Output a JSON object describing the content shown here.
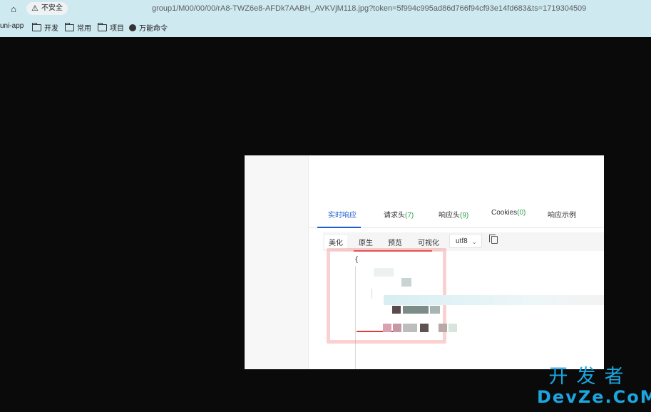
{
  "browser": {
    "security_label": "不安全",
    "url": "group1/M00/00/00/rA8-TWZ6e8-AFDk7AABH_AVKVjM118.jpg?token=5f994c995ad86d766f94cf93e14fd683&ts=1719304509"
  },
  "bookmarks": [
    {
      "label": "uni-app",
      "icon": "none"
    },
    {
      "label": "开发",
      "icon": "folder-icon"
    },
    {
      "label": "常用",
      "icon": "folder-icon"
    },
    {
      "label": "项目",
      "icon": "folder-icon"
    },
    {
      "label": "万能命令",
      "icon": "globe-icon"
    }
  ],
  "panel": {
    "tabs": [
      {
        "label": "实时响应",
        "count": ""
      },
      {
        "label": "请求头",
        "count": "(7)"
      },
      {
        "label": "响应头",
        "count": "(9)"
      },
      {
        "label": "Cookies",
        "count": "(0)"
      },
      {
        "label": "响应示例",
        "count": ""
      }
    ],
    "subtabs": [
      "美化",
      "原生",
      "预览",
      "可视化"
    ],
    "encoding": "utf8",
    "code_open_brace": "{"
  },
  "watermark": {
    "cn": "开发者",
    "en": "DevZe.CoM"
  },
  "colors": {
    "chrome": "#cfe9f0",
    "accent": "#1f5fd1",
    "count": "#2aa04a",
    "highlight": "#e53a3a",
    "watermark": "#1aa6e0"
  }
}
